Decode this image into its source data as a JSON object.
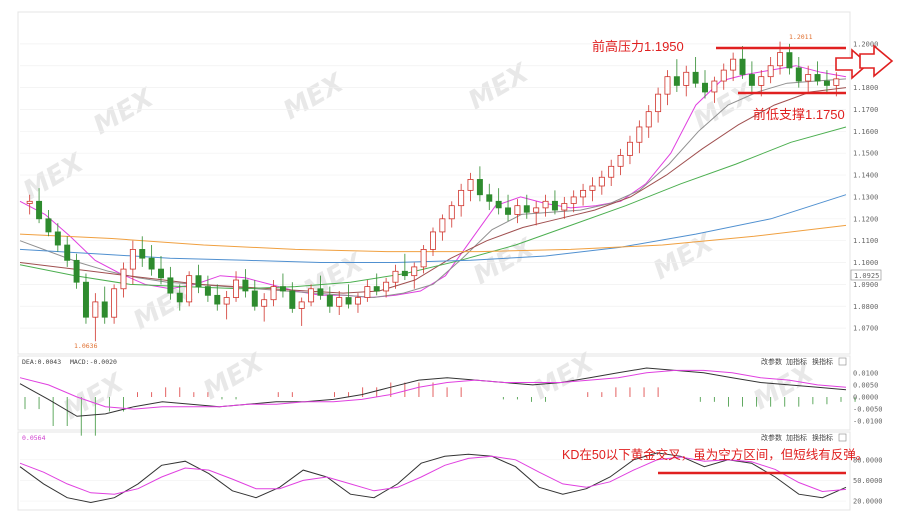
{
  "chart_data": [
    {
      "type": "candlestick",
      "panel": "price",
      "ylim": [
        1.06,
        1.21
      ],
      "y_ticks": [
        "1.2000",
        "1.1900",
        "1.1800",
        "1.1700",
        "1.1600",
        "1.1500",
        "1.1400",
        "1.1300",
        "1.1200",
        "1.1100",
        "1.1000",
        "1.0900",
        "1.0800",
        "1.0700"
      ],
      "current_price_label": "1.0925",
      "high_marker": "1.2011",
      "low_marker": "1.0636",
      "ohlc": [
        [
          1.127,
          1.131,
          1.122,
          1.128
        ],
        [
          1.128,
          1.134,
          1.118,
          1.12
        ],
        [
          1.12,
          1.124,
          1.112,
          1.114
        ],
        [
          1.114,
          1.118,
          1.105,
          1.108
        ],
        [
          1.108,
          1.112,
          1.098,
          1.101
        ],
        [
          1.101,
          1.104,
          1.088,
          1.091
        ],
        [
          1.091,
          1.095,
          1.072,
          1.075
        ],
        [
          1.075,
          1.086,
          1.064,
          1.082
        ],
        [
          1.082,
          1.089,
          1.072,
          1.075
        ],
        [
          1.075,
          1.09,
          1.072,
          1.088
        ],
        [
          1.088,
          1.1,
          1.084,
          1.097
        ],
        [
          1.097,
          1.11,
          1.09,
          1.106
        ],
        [
          1.106,
          1.112,
          1.098,
          1.102
        ],
        [
          1.102,
          1.108,
          1.094,
          1.097
        ],
        [
          1.097,
          1.103,
          1.09,
          1.093
        ],
        [
          1.093,
          1.098,
          1.083,
          1.086
        ],
        [
          1.086,
          1.09,
          1.078,
          1.082
        ],
        [
          1.082,
          1.096,
          1.08,
          1.094
        ],
        [
          1.094,
          1.099,
          1.086,
          1.089
        ],
        [
          1.089,
          1.094,
          1.082,
          1.085
        ],
        [
          1.085,
          1.09,
          1.078,
          1.081
        ],
        [
          1.081,
          1.087,
          1.074,
          1.084
        ],
        [
          1.084,
          1.096,
          1.082,
          1.092
        ],
        [
          1.092,
          1.097,
          1.084,
          1.087
        ],
        [
          1.087,
          1.092,
          1.078,
          1.08
        ],
        [
          1.08,
          1.086,
          1.073,
          1.083
        ],
        [
          1.083,
          1.092,
          1.08,
          1.089
        ],
        [
          1.089,
          1.095,
          1.084,
          1.087
        ],
        [
          1.087,
          1.091,
          1.077,
          1.079
        ],
        [
          1.079,
          1.084,
          1.071,
          1.082
        ],
        [
          1.082,
          1.09,
          1.08,
          1.088
        ],
        [
          1.088,
          1.094,
          1.083,
          1.085
        ],
        [
          1.085,
          1.089,
          1.077,
          1.08
        ],
        [
          1.08,
          1.087,
          1.076,
          1.084
        ],
        [
          1.084,
          1.09,
          1.079,
          1.081
        ],
        [
          1.081,
          1.086,
          1.077,
          1.084
        ],
        [
          1.084,
          1.092,
          1.082,
          1.089
        ],
        [
          1.089,
          1.095,
          1.085,
          1.087
        ],
        [
          1.087,
          1.093,
          1.084,
          1.091
        ],
        [
          1.091,
          1.099,
          1.088,
          1.096
        ],
        [
          1.096,
          1.104,
          1.092,
          1.094
        ],
        [
          1.094,
          1.1,
          1.088,
          1.098
        ],
        [
          1.098,
          1.108,
          1.095,
          1.106
        ],
        [
          1.106,
          1.116,
          1.103,
          1.114
        ],
        [
          1.114,
          1.122,
          1.11,
          1.12
        ],
        [
          1.12,
          1.128,
          1.116,
          1.126
        ],
        [
          1.126,
          1.136,
          1.121,
          1.133
        ],
        [
          1.133,
          1.141,
          1.128,
          1.138
        ],
        [
          1.138,
          1.144,
          1.128,
          1.131
        ],
        [
          1.131,
          1.136,
          1.124,
          1.128
        ],
        [
          1.128,
          1.134,
          1.122,
          1.125
        ],
        [
          1.125,
          1.131,
          1.119,
          1.122
        ],
        [
          1.122,
          1.129,
          1.118,
          1.126
        ],
        [
          1.126,
          1.131,
          1.12,
          1.123
        ],
        [
          1.123,
          1.128,
          1.117,
          1.125
        ],
        [
          1.125,
          1.131,
          1.121,
          1.128
        ],
        [
          1.128,
          1.133,
          1.122,
          1.124
        ],
        [
          1.124,
          1.13,
          1.12,
          1.127
        ],
        [
          1.127,
          1.133,
          1.123,
          1.13
        ],
        [
          1.13,
          1.136,
          1.126,
          1.133
        ],
        [
          1.133,
          1.139,
          1.128,
          1.135
        ],
        [
          1.135,
          1.142,
          1.131,
          1.139
        ],
        [
          1.139,
          1.147,
          1.135,
          1.144
        ],
        [
          1.144,
          1.152,
          1.14,
          1.149
        ],
        [
          1.149,
          1.158,
          1.145,
          1.155
        ],
        [
          1.155,
          1.165,
          1.15,
          1.162
        ],
        [
          1.162,
          1.172,
          1.157,
          1.169
        ],
        [
          1.169,
          1.18,
          1.164,
          1.177
        ],
        [
          1.177,
          1.188,
          1.172,
          1.185
        ],
        [
          1.185,
          1.193,
          1.178,
          1.181
        ],
        [
          1.181,
          1.19,
          1.176,
          1.187
        ],
        [
          1.187,
          1.194,
          1.18,
          1.182
        ],
        [
          1.182,
          1.188,
          1.175,
          1.178
        ],
        [
          1.178,
          1.185,
          1.173,
          1.183
        ],
        [
          1.183,
          1.191,
          1.179,
          1.188
        ],
        [
          1.188,
          1.196,
          1.183,
          1.193
        ],
        [
          1.193,
          1.199,
          1.184,
          1.186
        ],
        [
          1.186,
          1.192,
          1.178,
          1.181
        ],
        [
          1.181,
          1.188,
          1.176,
          1.185
        ],
        [
          1.185,
          1.194,
          1.182,
          1.19
        ],
        [
          1.19,
          1.201,
          1.186,
          1.196
        ],
        [
          1.196,
          1.2,
          1.186,
          1.189
        ],
        [
          1.189,
          1.194,
          1.18,
          1.183
        ],
        [
          1.183,
          1.19,
          1.178,
          1.186
        ],
        [
          1.186,
          1.192,
          1.181,
          1.183
        ],
        [
          1.183,
          1.188,
          1.177,
          1.181
        ],
        [
          1.181,
          1.187,
          1.176,
          1.184
        ]
      ],
      "moving_averages": [
        {
          "color": "#e040e0",
          "start": 1.128,
          "values": [
            1.122,
            1.112,
            1.101,
            1.095,
            1.09,
            1.088,
            1.09,
            1.094,
            1.093,
            1.09,
            1.087,
            1.085,
            1.085,
            1.084,
            1.085,
            1.087,
            1.094,
            1.11,
            1.126,
            1.13,
            1.127,
            1.125,
            1.126,
            1.128,
            1.136,
            1.15,
            1.172,
            1.183,
            1.186,
            1.188,
            1.19,
            1.187,
            1.185
          ]
        },
        {
          "color": "#909090",
          "start": 1.11,
          "values": [
            1.105,
            1.1,
            1.096,
            1.093,
            1.091,
            1.09,
            1.089,
            1.088,
            1.087,
            1.086,
            1.085,
            1.084,
            1.086,
            1.09,
            1.102,
            1.115,
            1.122,
            1.123,
            1.124,
            1.127,
            1.133,
            1.145,
            1.16,
            1.172,
            1.178,
            1.182,
            1.183,
            1.184
          ]
        },
        {
          "color": "#a05050",
          "start": 1.1,
          "values": [
            1.098,
            1.096,
            1.094,
            1.092,
            1.09,
            1.089,
            1.088,
            1.087,
            1.086,
            1.087,
            1.092,
            1.102,
            1.11,
            1.116,
            1.12,
            1.124,
            1.13,
            1.14,
            1.152,
            1.163,
            1.172,
            1.178,
            1.18
          ]
        },
        {
          "color": "#4caf50",
          "start": 1.099,
          "values": [
            1.094,
            1.09,
            1.089,
            1.088,
            1.089,
            1.091,
            1.095,
            1.101,
            1.108,
            1.117,
            1.126,
            1.136,
            1.145,
            1.155,
            1.162
          ]
        },
        {
          "color": "#5090d0",
          "start": 1.106,
          "values": [
            1.104,
            1.102,
            1.101,
            1.1,
            1.1,
            1.101,
            1.103,
            1.107,
            1.113,
            1.12,
            1.131
          ]
        },
        {
          "color": "#f0a040",
          "start": 1.113,
          "values": [
            1.111,
            1.108,
            1.106,
            1.105,
            1.105,
            1.106,
            1.108,
            1.112,
            1.117
          ]
        }
      ]
    },
    {
      "type": "line",
      "panel": "macd",
      "ylim": [
        -0.012,
        0.012
      ],
      "y_ticks": [
        "0.0100",
        "0.0050",
        "0.0000",
        "-0.0050",
        "-0.0100"
      ],
      "series": [
        {
          "color": "#333333",
          "values": [
            0.0055,
            -0.001,
            -0.008,
            -0.007,
            -0.004,
            -0.002,
            -0.003,
            -0.004,
            -0.003,
            -0.002,
            -0.002,
            -0.001,
            0.001,
            0.004,
            0.007,
            0.008,
            0.007,
            0.006,
            0.005,
            0.006,
            0.008,
            0.01,
            0.012,
            0.011,
            0.01,
            0.008,
            0.006,
            0.005,
            0.004,
            0.003
          ]
        },
        {
          "color": "#e040e0",
          "values": [
            0.008,
            0.005,
            0.0,
            -0.004,
            -0.005,
            -0.004,
            -0.004,
            -0.004,
            -0.003,
            -0.003,
            -0.002,
            -0.002,
            -0.001,
            0.001,
            0.004,
            0.006,
            0.007,
            0.006,
            0.006,
            0.006,
            0.007,
            0.008,
            0.01,
            0.011,
            0.011,
            0.01,
            0.008,
            0.007,
            0.005,
            0.004
          ]
        }
      ],
      "histogram": [
        -0.005,
        -0.012,
        -0.016,
        -0.006,
        0.002,
        0.004,
        0.002,
        -0.001,
        0.0,
        0.002,
        0.0,
        0.002,
        0.004,
        0.006,
        0.006,
        0.004,
        0.0,
        -0.001,
        -0.002,
        0.0,
        0.002,
        0.004,
        0.004,
        0.0,
        -0.002,
        -0.004,
        -0.004,
        -0.004,
        -0.003,
        -0.002
      ]
    },
    {
      "type": "line",
      "panel": "kd",
      "ylim": [
        10,
        100
      ],
      "y_ticks": [
        "80.0000",
        "50.0000",
        "20.0000"
      ],
      "series": [
        {
          "color": "#333333",
          "values": [
            70,
            45,
            25,
            18,
            25,
            45,
            72,
            78,
            60,
            35,
            25,
            40,
            65,
            55,
            30,
            25,
            45,
            75,
            85,
            88,
            85,
            70,
            40,
            30,
            38,
            55,
            80,
            90,
            85,
            70,
            80,
            75,
            55,
            30,
            25,
            40
          ]
        },
        {
          "color": "#e040e0",
          "values": [
            75,
            62,
            45,
            32,
            30,
            38,
            55,
            68,
            65,
            52,
            38,
            38,
            50,
            55,
            45,
            35,
            40,
            55,
            72,
            82,
            85,
            80,
            62,
            45,
            40,
            48,
            65,
            80,
            84,
            78,
            80,
            77,
            66,
            47,
            34,
            37
          ]
        }
      ]
    }
  ],
  "indicators": {
    "dea": "DEA:0.0043",
    "macd": "MACD:-0.0020",
    "kd": "0.0564"
  },
  "controls": [
    "改参数",
    "加指标",
    "换指标"
  ],
  "annotations": {
    "resistance": "前高压力1.1950",
    "support": "前低支撑1.1750",
    "kd_note": "KD在50以下黄金交叉，虽为空方区间，但短线有反弹。"
  },
  "watermark": "MEX",
  "colors": {
    "up": "#d0342c",
    "down": "#2e8b2e",
    "annotation": "#e02020"
  }
}
